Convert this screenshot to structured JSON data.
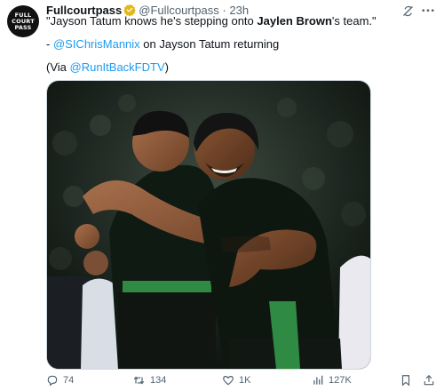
{
  "account": {
    "display_name": "Fullcourtpass",
    "handle": "@Fullcourtpass",
    "separator": "·",
    "time": "23h",
    "avatar_lines": [
      "FULL",
      "COURT",
      "PASS"
    ]
  },
  "tweet": {
    "quote_open": "\"Jayson Tatum knows he's stepping onto ",
    "quote_bold": "Jaylen Brown",
    "quote_close": "'s team.\"",
    "credit_prefix": "- ",
    "credit_mention": "@SIChrisMannix",
    "credit_suffix": " on Jayson Tatum returning",
    "via_open": "(Via ",
    "via_mention": "@RunItBackFDTV",
    "via_close": ")"
  },
  "actions": {
    "replies": "74",
    "reposts": "134",
    "likes": "1K",
    "views": "127K"
  },
  "icons": {
    "header": [
      "verified-badge-icon",
      "grok-icon",
      "more-icon"
    ],
    "actions": [
      "reply-icon",
      "retweet-icon",
      "like-icon",
      "views-icon",
      "bookmark-icon",
      "share-icon"
    ]
  },
  "colors": {
    "accent": "#1d9bf0",
    "verified": "#e2b719",
    "celtics_green": "#0f5a2e",
    "text_secondary": "#536471"
  }
}
